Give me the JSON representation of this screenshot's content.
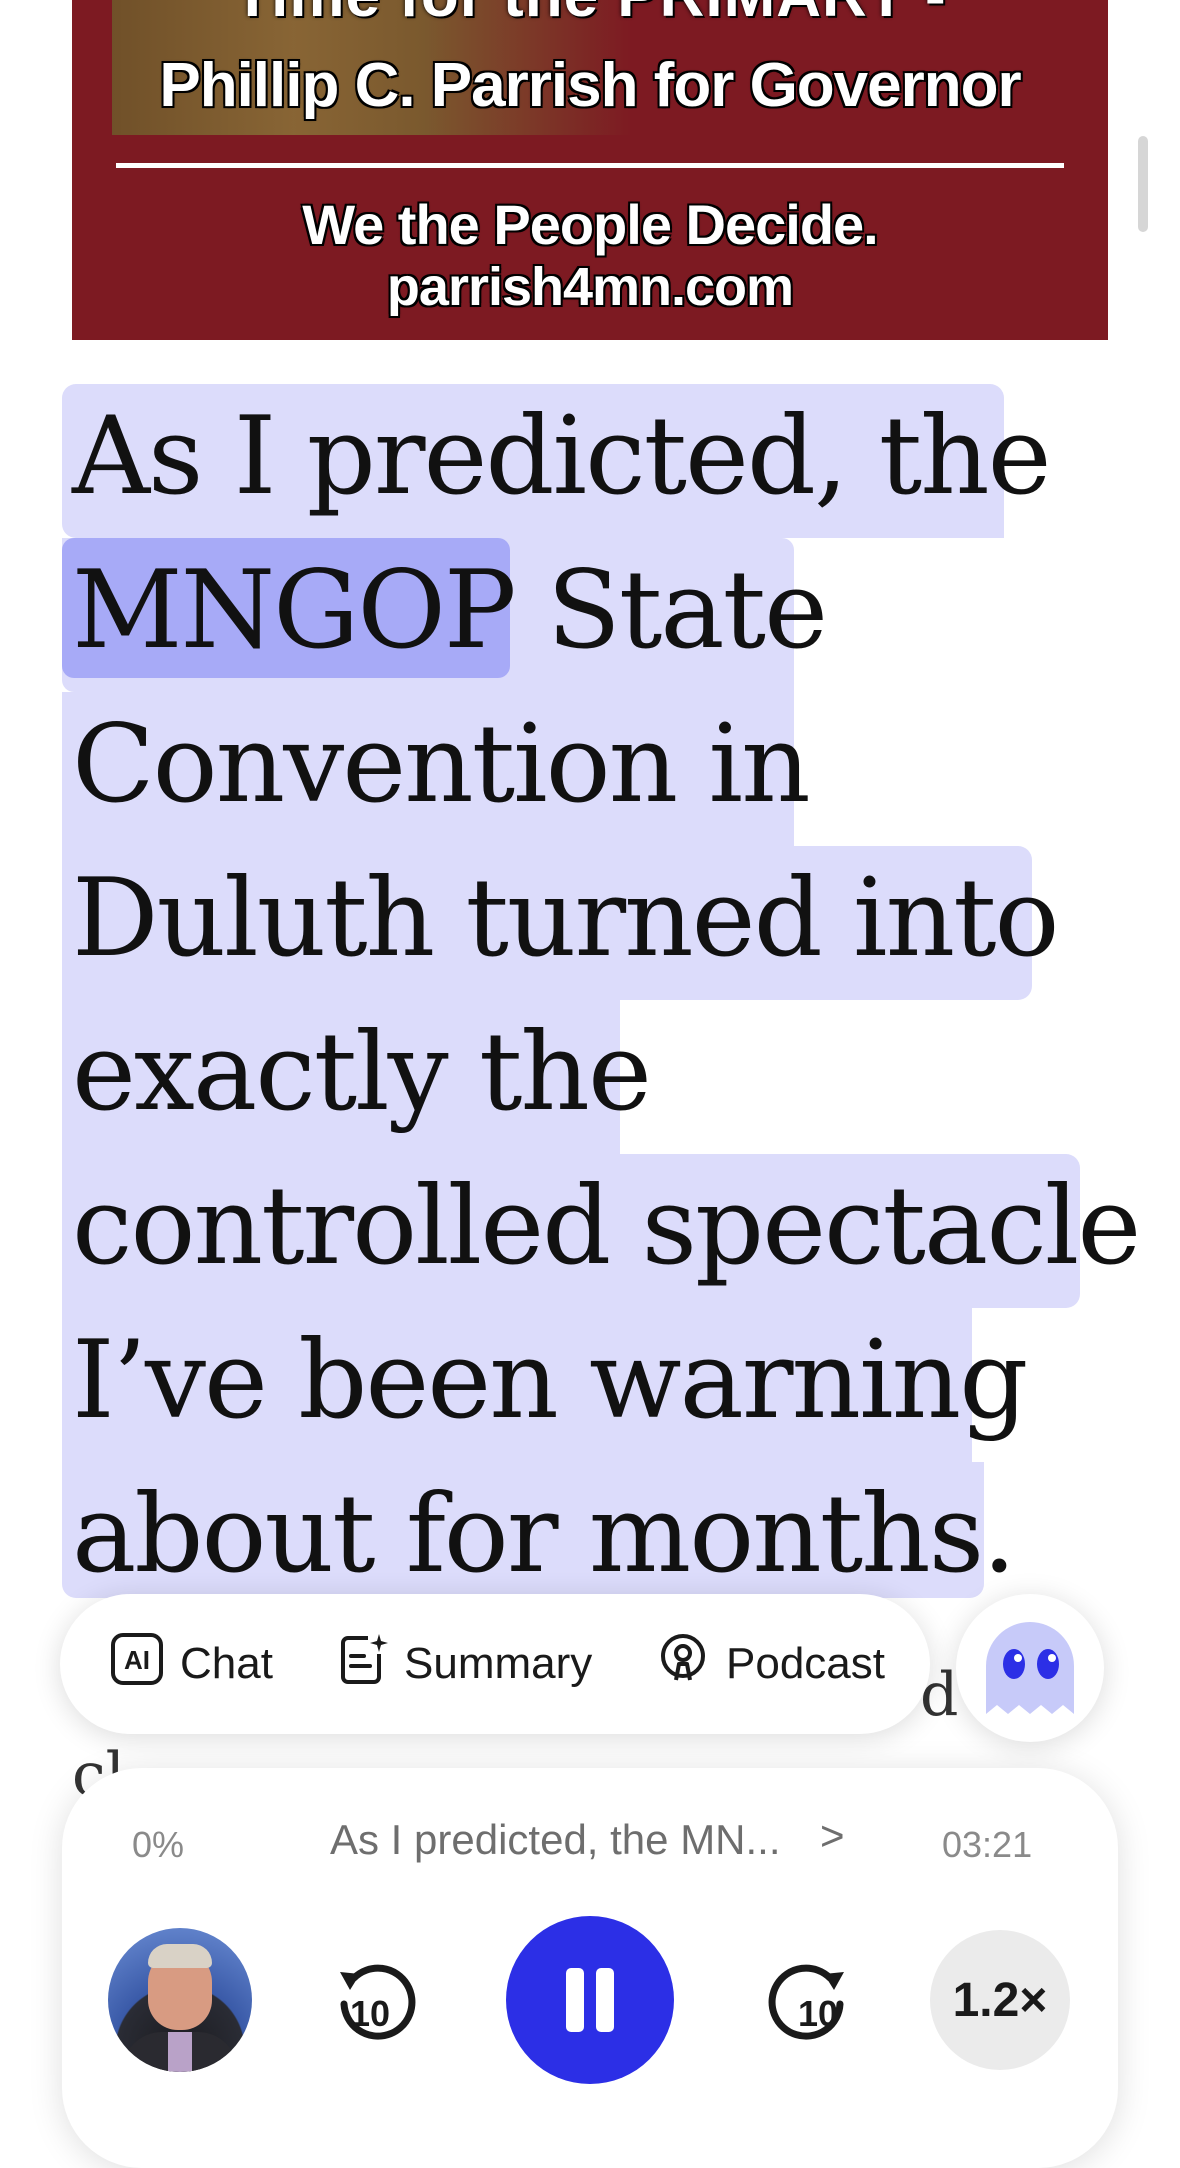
{
  "banner": {
    "cut_line": "Time for the PRIMARY -",
    "line1": "Phillip C. Parrish for Governor",
    "line2": "We the People Decide.",
    "line3": "parrish4mn.com"
  },
  "article": {
    "lines": [
      "As I predicted, the",
      "MNGOP State",
      "Convention in",
      "Duluth turned into",
      "exactly the",
      "controlled spectacle",
      "I’ve been warning",
      "about for months."
    ],
    "current_word": "MNGOP",
    "peek_line_1_tail": "d",
    "peek_line_2": "cl"
  },
  "actions": {
    "chat_label": "Chat",
    "chat_icon_text": "AI",
    "summary_label": "Summary",
    "podcast_label": "Podcast"
  },
  "player": {
    "progress": "0%",
    "title": "As I predicted, the MN...",
    "chevron": ">",
    "duration": "03:21",
    "skip_back_label": "10",
    "skip_forward_label": "10",
    "speed": "1.2×"
  },
  "colors": {
    "highlight": "#dcdcfb",
    "word_highlight": "#a7aaf7",
    "accent": "#2c2fe6",
    "banner": "#7d1a22"
  },
  "icons": [
    "ai-chat-icon",
    "summary-icon",
    "podcast-icon",
    "ghost-assistant-icon",
    "skip-back-10-icon",
    "pause-icon",
    "skip-forward-10-icon"
  ]
}
